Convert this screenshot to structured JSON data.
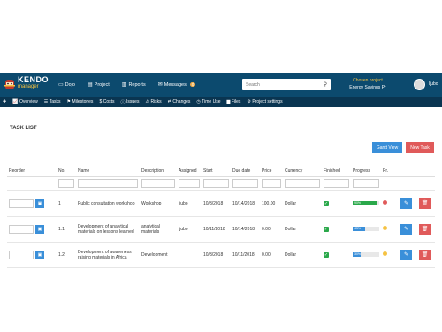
{
  "app": {
    "logo_top": "KENDO",
    "logo_bottom": "manager"
  },
  "topnav": [
    {
      "label": "Dojo",
      "icon": "dojo-icon"
    },
    {
      "label": "Project",
      "icon": "project-icon"
    },
    {
      "label": "Reports",
      "icon": "reports-icon"
    },
    {
      "label": "Messages",
      "icon": "envelope-icon",
      "badge": "0"
    }
  ],
  "search": {
    "placeholder": "Search"
  },
  "project": {
    "label": "Chosen project",
    "value": "Energy Savings Pr"
  },
  "user": {
    "name": "ljubo"
  },
  "subnav": [
    {
      "label": "Overview",
      "icon": "chart-icon"
    },
    {
      "label": "Tasks",
      "icon": "tasks-icon"
    },
    {
      "label": "Milestones",
      "icon": "flag-icon"
    },
    {
      "label": "Costs",
      "icon": "dollar-icon"
    },
    {
      "label": "Issues",
      "icon": "info-icon"
    },
    {
      "label": "Risks",
      "icon": "warning-icon"
    },
    {
      "label": "Changes",
      "icon": "changes-icon"
    },
    {
      "label": "Time Use",
      "icon": "clock-icon"
    },
    {
      "label": "Files",
      "icon": "folder-icon"
    },
    {
      "label": "Project settings",
      "icon": "gears-icon"
    }
  ],
  "panel": {
    "title": "TASK LIST",
    "gantt_label": "Gantt View",
    "new_task_label": "New Task"
  },
  "table": {
    "headers": [
      "Reorder",
      "No.",
      "Name",
      "Description",
      "Assigned",
      "Start",
      "Due date",
      "Price",
      "Currency",
      "Finished",
      "Progress",
      "Pr.",
      "",
      ""
    ],
    "rows": [
      {
        "no": "1",
        "name": "Public consultation workshop",
        "description": "Workshop",
        "assigned": "ljubo",
        "start": "10/3/2018",
        "due": "10/14/2018",
        "price": "100.00",
        "currency": "Dollar",
        "finished": true,
        "progress": 0.9,
        "progress_color": "#2aa84a",
        "progress_text": "90%",
        "priority": "red"
      },
      {
        "no": "1.1",
        "name": "Development of analytical materials on lessons learned",
        "description": "analytical materials",
        "assigned": "ljubo",
        "start": "10/11/2018",
        "due": "10/14/2018",
        "price": "0.00",
        "currency": "Dollar",
        "finished": true,
        "progress": 0.45,
        "progress_color": "#3a8fd9",
        "progress_text": "45%",
        "priority": "yellow"
      },
      {
        "no": "1.2",
        "name": "Development of awareness raising materials in Africa",
        "description": "Development",
        "assigned": "",
        "start": "10/3/2018",
        "due": "10/11/2018",
        "price": "0.00",
        "currency": "Dollar",
        "finished": true,
        "progress": 0.3,
        "progress_color": "#3a8fd9",
        "progress_text": "30%",
        "priority": "yellow"
      }
    ]
  }
}
